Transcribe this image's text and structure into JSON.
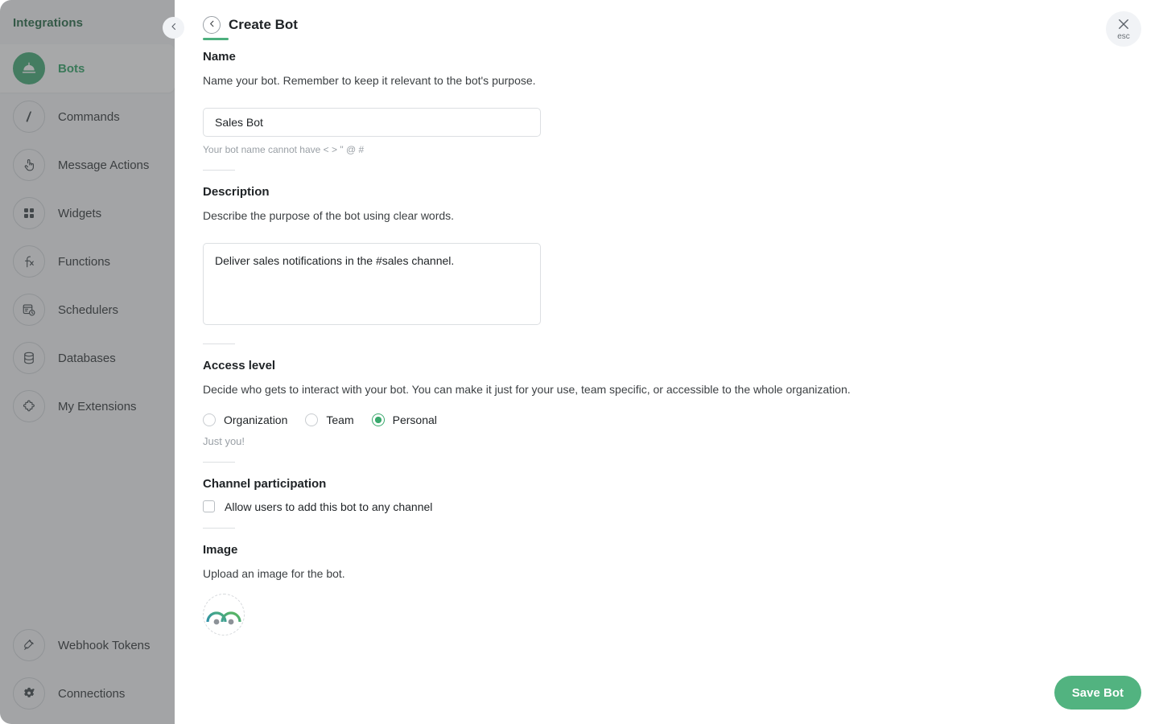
{
  "sidebar": {
    "title": "Integrations",
    "collapse_icon": "chevron-left-icon",
    "items": [
      {
        "label": "Bots",
        "icon": "bot-icon",
        "active": true
      },
      {
        "label": "Commands",
        "icon": "slash-command-icon",
        "active": false
      },
      {
        "label": "Message Actions",
        "icon": "tap-hand-icon",
        "active": false
      },
      {
        "label": "Widgets",
        "icon": "grid-squares-icon",
        "active": false
      },
      {
        "label": "Functions",
        "icon": "function-icon",
        "active": false
      },
      {
        "label": "Schedulers",
        "icon": "calendar-clock-icon",
        "active": false
      },
      {
        "label": "Databases",
        "icon": "database-icon",
        "active": false
      },
      {
        "label": "My Extensions",
        "icon": "puzzle-piece-icon",
        "active": false
      }
    ],
    "bottom_items": [
      {
        "label": "Webhook Tokens",
        "icon": "plug-icon"
      },
      {
        "label": "Connections",
        "icon": "gear-icon"
      }
    ]
  },
  "header": {
    "back_icon": "chevron-left-icon",
    "title": "Create Bot",
    "close_icon": "close-icon",
    "close_label": "esc"
  },
  "form": {
    "name": {
      "title": "Name",
      "description": "Name your bot. Remember to keep it relevant to the bot's purpose.",
      "value": "Sales Bot",
      "placeholder": "",
      "hint": "Your bot name cannot have < > \" @ #"
    },
    "description": {
      "title": "Description",
      "description": "Describe the purpose of the bot using clear words.",
      "value": "Deliver sales notifications in the #sales channel.",
      "placeholder": ""
    },
    "access_level": {
      "title": "Access level",
      "description": "Decide who gets to interact with your bot. You can make it just for your use, team specific, or accessible to the whole organization.",
      "options": [
        {
          "label": "Organization",
          "selected": false
        },
        {
          "label": "Team",
          "selected": false
        },
        {
          "label": "Personal",
          "selected": true
        }
      ],
      "selected_hint": "Just you!"
    },
    "channel_participation": {
      "title": "Channel participation",
      "checkbox_label": "Allow users to add this bot to any channel",
      "checked": false
    },
    "image": {
      "title": "Image",
      "description": "Upload an image for the bot.",
      "upload_icon": "avatar-upload-icon"
    }
  },
  "footer": {
    "save_label": "Save Bot"
  },
  "colors": {
    "accent_green": "#4caf7d",
    "brand_green_text": "#3aa96d",
    "title_green": "#2f6f4e",
    "save_button": "#52b380"
  }
}
